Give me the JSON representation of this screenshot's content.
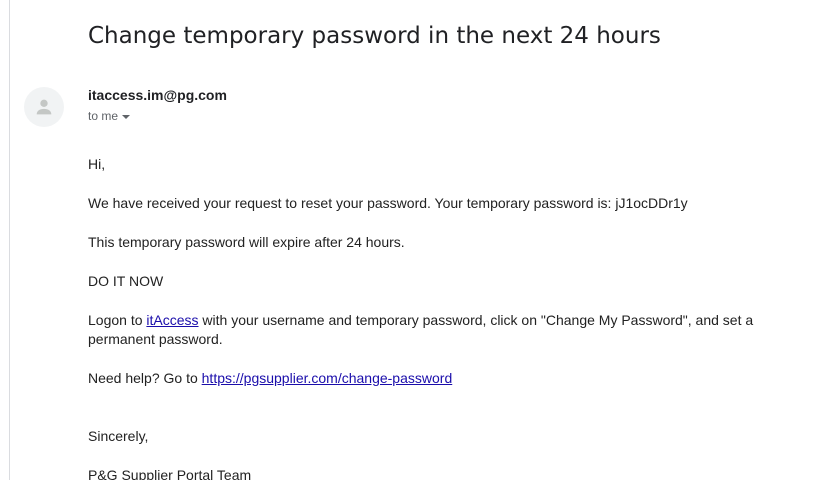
{
  "email": {
    "subject": "Change temporary password in the next 24 hours",
    "sender": "itaccess.im@pg.com",
    "recipient_label": "to me",
    "avatar_icon": "person-icon",
    "greeting": "Hi,",
    "paragraph_request": "We have received your request to reset your password. Your temporary password is: jJ1ocDDr1y",
    "paragraph_expire": "This temporary password will expire after 24 hours.",
    "paragraph_urgent": "DO IT NOW",
    "logon": {
      "before": "Logon to ",
      "link_text": "itAccess",
      "after_line1": " with your username and temporary password, click on \"Change My Password\", and set a",
      "line2": "permanent password."
    },
    "help": {
      "before": "Need help? Go to ",
      "link_text": "https://pgsupplier.com/change-password"
    },
    "closing": "Sincerely,",
    "signature": "P&G Supplier Portal Team"
  },
  "colors": {
    "link": "#1a0dab",
    "text": "#222222",
    "muted": "#5f6368",
    "avatar_bg": "#f1f3f4"
  }
}
